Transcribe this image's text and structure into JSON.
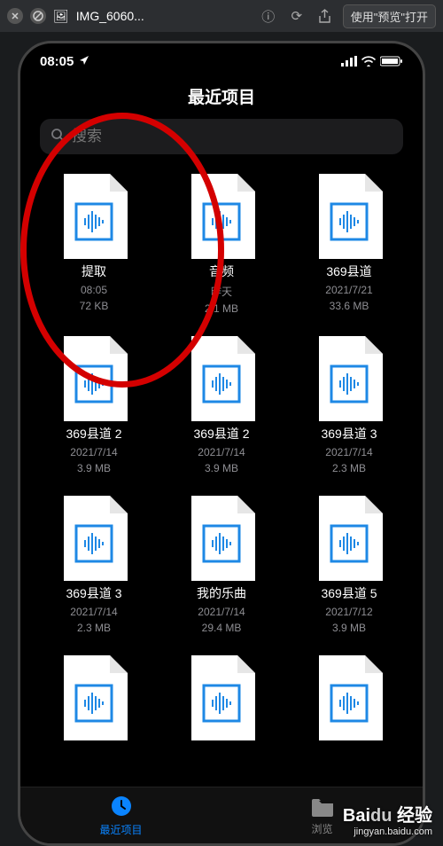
{
  "topbar": {
    "filename": "IMG_6060...",
    "open_label": "使用\"预览\"打开"
  },
  "statusbar": {
    "time": "08:05"
  },
  "page": {
    "title": "最近项目"
  },
  "search": {
    "placeholder": "搜索"
  },
  "files": [
    {
      "name": "提取",
      "date": "08:05",
      "size": "72 KB"
    },
    {
      "name": "音频",
      "date": "昨天",
      "size": "2.1 MB"
    },
    {
      "name": "369县道",
      "date": "2021/7/21",
      "size": "33.6 MB"
    },
    {
      "name": "369县道 2",
      "date": "2021/7/14",
      "size": "3.9 MB"
    },
    {
      "name": "369县道 2",
      "date": "2021/7/14",
      "size": "3.9 MB"
    },
    {
      "name": "369县道 3",
      "date": "2021/7/14",
      "size": "2.3 MB"
    },
    {
      "name": "369县道 3",
      "date": "2021/7/14",
      "size": "2.3 MB"
    },
    {
      "name": "我的乐曲",
      "date": "2021/7/14",
      "size": "29.4 MB"
    },
    {
      "name": "369县道 5",
      "date": "2021/7/12",
      "size": "3.9 MB"
    },
    {
      "name": "",
      "date": "",
      "size": ""
    },
    {
      "name": "",
      "date": "",
      "size": ""
    },
    {
      "name": "",
      "date": "",
      "size": ""
    }
  ],
  "tabs": {
    "recents": "最近项目",
    "browse": "浏览"
  },
  "watermark": {
    "brand_a": "Bai",
    "brand_b": "du",
    "brand_c": "经验",
    "url": "jingyan.baidu.com"
  }
}
